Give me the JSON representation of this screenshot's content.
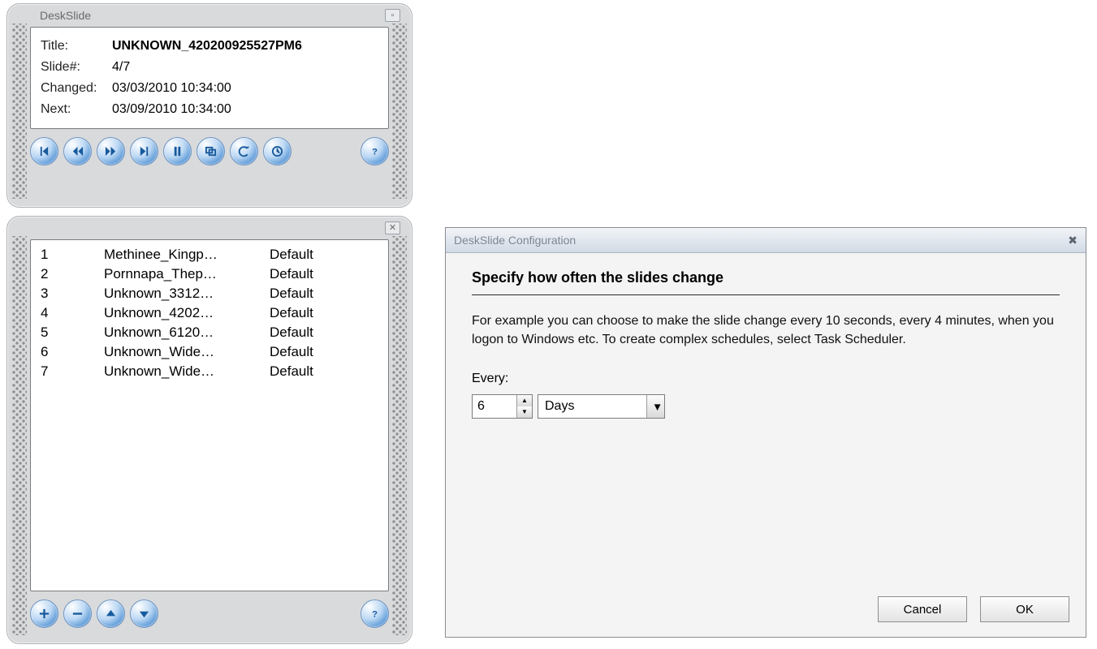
{
  "main": {
    "window_title": "DeskSlide",
    "labels": {
      "title": "Title:",
      "slide": "Slide#:",
      "changed": "Changed:",
      "next": "Next:"
    },
    "values": {
      "title": "UNKNOWN_420200925527PM6",
      "slide": "4/7",
      "changed": "03/03/2010 10:34:00",
      "next": "03/09/2010 10:34:00"
    },
    "buttons": {
      "first": "skip-first",
      "prev": "rewind",
      "next_b": "forward",
      "last": "skip-last",
      "pause": "pause",
      "cycle": "cycle",
      "undo": "undo",
      "clock": "clock",
      "help": "help"
    }
  },
  "list": {
    "items": [
      {
        "n": "1",
        "name": "Methinee_Kingp…",
        "def": "Default"
      },
      {
        "n": "2",
        "name": "Pornnapa_Thep…",
        "def": "Default"
      },
      {
        "n": "3",
        "name": "Unknown_3312…",
        "def": "Default"
      },
      {
        "n": "4",
        "name": "Unknown_4202…",
        "def": "Default"
      },
      {
        "n": "5",
        "name": "Unknown_6120…",
        "def": "Default"
      },
      {
        "n": "6",
        "name": "Unknown_Wide…",
        "def": "Default"
      },
      {
        "n": "7",
        "name": "Unknown_Wide…",
        "def": "Default"
      }
    ],
    "buttons": {
      "add": "plus",
      "remove": "minus",
      "up": "up",
      "down": "down",
      "help": "help"
    }
  },
  "config": {
    "title": "DeskSlide Configuration",
    "heading": "Specify how often the slides change",
    "body": "For example you can choose to make the slide change every 10 seconds, every 4 minutes, when you logon to Windows etc. To create complex schedules, select Task Scheduler.",
    "every_label": "Every:",
    "value": "6",
    "unit": "Days",
    "cancel": "Cancel",
    "ok": "OK"
  }
}
